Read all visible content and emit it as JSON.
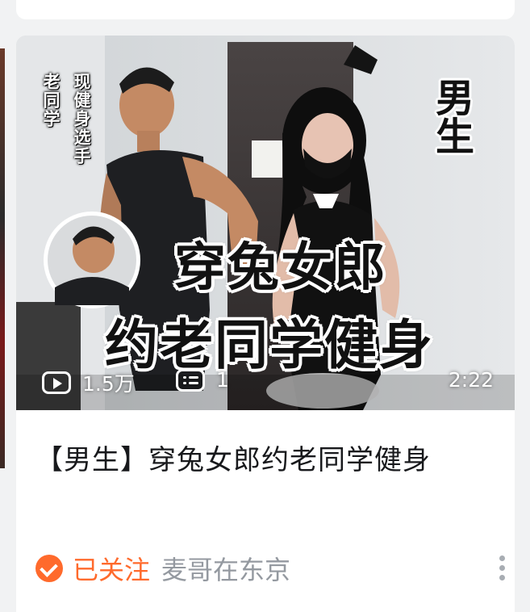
{
  "video": {
    "thumb_left_tag": "老同学",
    "thumb_right_tag": "现健身选手",
    "thumb_corner_tag": "男生",
    "thumb_title_line1": "穿兔女郎",
    "thumb_title_line2": "约老同学健身",
    "play_count": "1.5万",
    "danmaku_count": "1",
    "duration": "2:22",
    "title": "【男生】穿兔女郎约老同学健身",
    "follow_status": "已关注",
    "author": "麦哥在东京"
  },
  "icons": {
    "play": "play-count-icon",
    "danmaku": "danmaku-icon",
    "followed": "followed-check-icon",
    "more": "more-vertical-icon"
  },
  "colors": {
    "accent": "#ff6a2c",
    "muted_text": "#9499a0",
    "title_text": "#18191c",
    "background": "#f1f2f3"
  }
}
